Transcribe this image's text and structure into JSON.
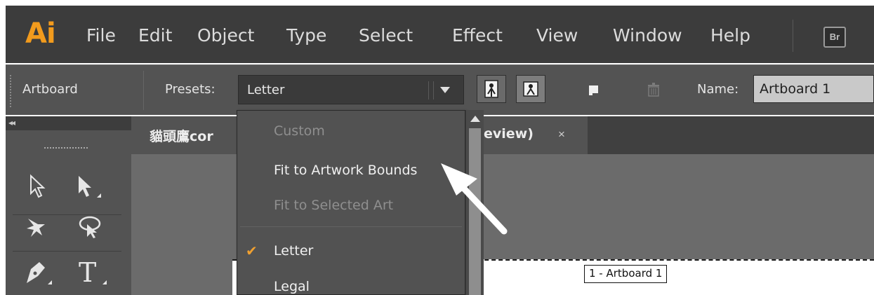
{
  "app": {
    "logo": "Ai"
  },
  "menu": [
    "File",
    "Edit",
    "Object",
    "Type",
    "Select",
    "Effect",
    "View",
    "Window",
    "Help"
  ],
  "bridge_button": "Br",
  "control_bar": {
    "mode_label": "Artboard",
    "presets_label": "Presets:",
    "presets_value": "Letter",
    "name_label": "Name:",
    "name_value": "Artboard 1"
  },
  "document_tab": {
    "title_start": "貓頭鷹cor",
    "title_end": "eview)",
    "close": "×"
  },
  "dropdown": {
    "items": [
      {
        "label": "Custom",
        "enabled": false
      },
      {
        "label": "Fit to Artwork Bounds",
        "enabled": true
      },
      {
        "label": "Fit to Selected Art",
        "enabled": false
      },
      {
        "label": "Letter",
        "enabled": true,
        "checked": true
      },
      {
        "label": "Legal",
        "enabled": true
      }
    ],
    "check_mark": "✔"
  },
  "artboard_label": "1 - Artboard 1",
  "colors": {
    "menubar_bg": "#3c3c3c",
    "controlbar_bg": "#535353",
    "canvas_bg": "#6b6b6b",
    "ai_orange": "#f29b1d",
    "check_orange": "#f0a030"
  }
}
